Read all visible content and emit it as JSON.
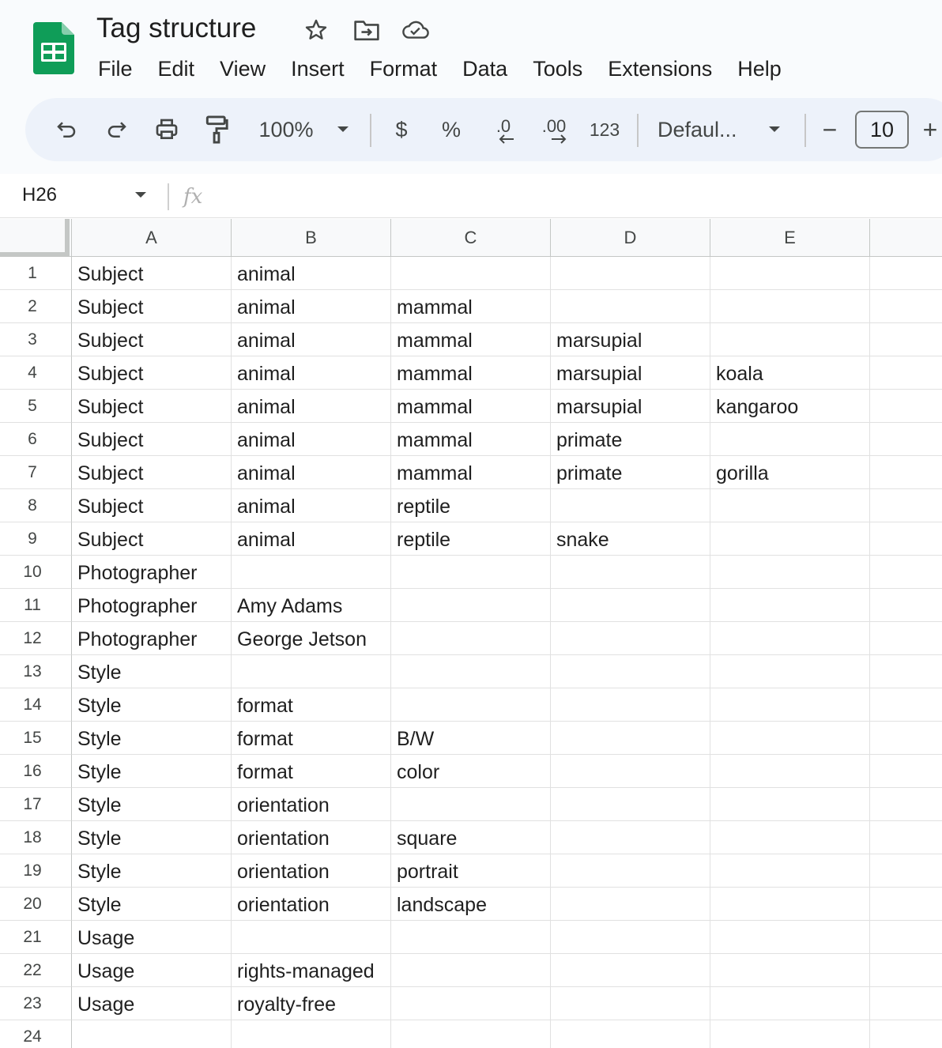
{
  "document": {
    "title": "Tag structure"
  },
  "menu": [
    "File",
    "Edit",
    "View",
    "Insert",
    "Format",
    "Data",
    "Tools",
    "Extensions",
    "Help"
  ],
  "toolbar": {
    "zoom": "100%",
    "currency_label": "$",
    "percent_label": "%",
    "decrease_decimal_label": ".0",
    "increase_decimal_label": ".00",
    "number_format_label": "123",
    "font": "Defaul...",
    "font_size": "10",
    "decrease_size_label": "−",
    "increase_size_label": "+"
  },
  "formula_bar": {
    "cell_ref": "H26",
    "fx_label": "fx"
  },
  "grid": {
    "columns": [
      "A",
      "B",
      "C",
      "D",
      "E"
    ],
    "rows": [
      {
        "n": "1",
        "cells": [
          "Subject",
          "animal",
          "",
          "",
          ""
        ]
      },
      {
        "n": "2",
        "cells": [
          "Subject",
          "animal",
          "mammal",
          "",
          ""
        ]
      },
      {
        "n": "3",
        "cells": [
          "Subject",
          "animal",
          "mammal",
          "marsupial",
          ""
        ]
      },
      {
        "n": "4",
        "cells": [
          "Subject",
          "animal",
          "mammal",
          "marsupial",
          "koala"
        ]
      },
      {
        "n": "5",
        "cells": [
          "Subject",
          "animal",
          "mammal",
          "marsupial",
          "kangaroo"
        ]
      },
      {
        "n": "6",
        "cells": [
          "Subject",
          "animal",
          "mammal",
          "primate",
          ""
        ]
      },
      {
        "n": "7",
        "cells": [
          "Subject",
          "animal",
          "mammal",
          "primate",
          "gorilla"
        ]
      },
      {
        "n": "8",
        "cells": [
          "Subject",
          "animal",
          "reptile",
          "",
          ""
        ]
      },
      {
        "n": "9",
        "cells": [
          "Subject",
          "animal",
          "reptile",
          "snake",
          ""
        ]
      },
      {
        "n": "10",
        "cells": [
          "Photographer",
          "",
          "",
          "",
          ""
        ]
      },
      {
        "n": "11",
        "cells": [
          "Photographer",
          "Amy Adams",
          "",
          "",
          ""
        ]
      },
      {
        "n": "12",
        "cells": [
          "Photographer",
          "George Jetson",
          "",
          "",
          ""
        ]
      },
      {
        "n": "13",
        "cells": [
          "Style",
          "",
          "",
          "",
          ""
        ]
      },
      {
        "n": "14",
        "cells": [
          "Style",
          "format",
          "",
          "",
          ""
        ]
      },
      {
        "n": "15",
        "cells": [
          "Style",
          "format",
          "B/W",
          "",
          ""
        ]
      },
      {
        "n": "16",
        "cells": [
          "Style",
          "format",
          "color",
          "",
          ""
        ]
      },
      {
        "n": "17",
        "cells": [
          "Style",
          "orientation",
          "",
          "",
          ""
        ]
      },
      {
        "n": "18",
        "cells": [
          "Style",
          "orientation",
          "square",
          "",
          ""
        ]
      },
      {
        "n": "19",
        "cells": [
          "Style",
          "orientation",
          "portrait",
          "",
          ""
        ]
      },
      {
        "n": "20",
        "cells": [
          "Style",
          "orientation",
          "landscape",
          "",
          ""
        ]
      },
      {
        "n": "21",
        "cells": [
          "Usage",
          "",
          "",
          "",
          ""
        ]
      },
      {
        "n": "22",
        "cells": [
          "Usage",
          "rights-managed",
          "",
          "",
          ""
        ]
      },
      {
        "n": "23",
        "cells": [
          "Usage",
          "royalty-free",
          "",
          "",
          ""
        ]
      },
      {
        "n": "24",
        "cells": [
          "",
          "",
          "",
          "",
          ""
        ]
      }
    ]
  },
  "icons": {
    "app_logo": "sheets-logo-icon",
    "star": "star-icon",
    "move": "move-to-folder-icon",
    "cloud": "cloud-saved-icon",
    "undo": "undo-icon",
    "redo": "redo-icon",
    "print": "print-icon",
    "paint": "paint-format-icon"
  },
  "colors": {
    "brand_green": "#0F9D58",
    "toolbar_bg": "#edf2fa",
    "header_bg": "#f9fbfd"
  }
}
